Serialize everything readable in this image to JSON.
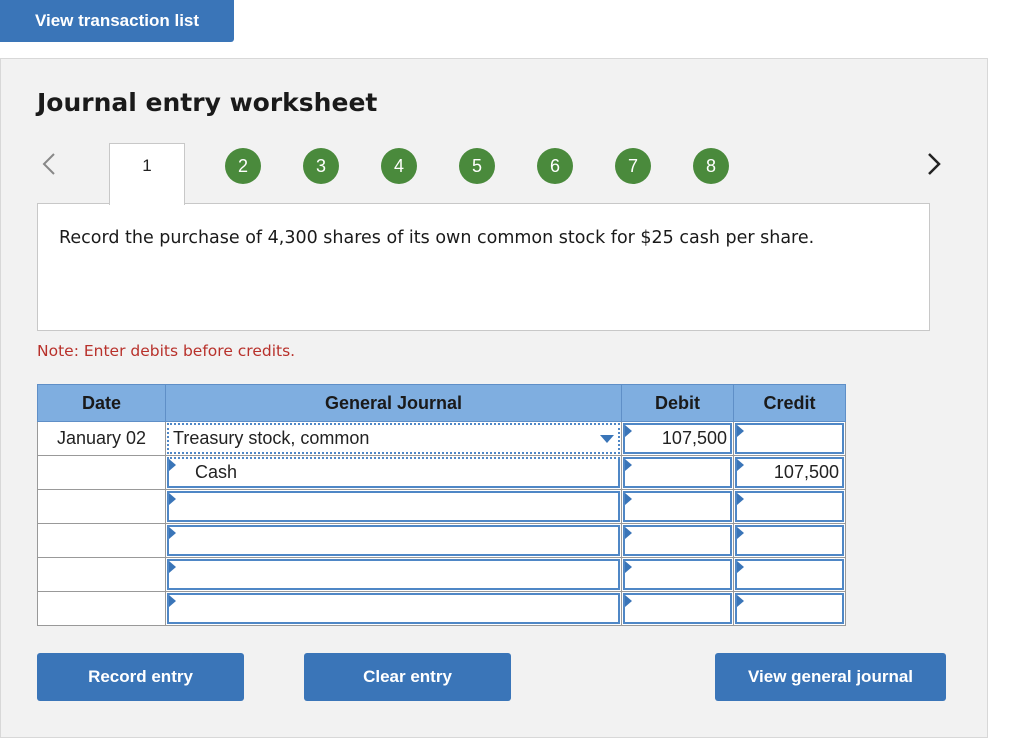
{
  "header": {
    "view_transactions_label": "View transaction list"
  },
  "worksheet": {
    "title": "Journal entry worksheet",
    "steps": [
      "1",
      "2",
      "3",
      "4",
      "5",
      "6",
      "7",
      "8"
    ],
    "active_step": "1",
    "prompt": "Record the purchase of 4,300 shares of its own common stock for $25 cash per share.",
    "note": "Note: Enter debits before credits."
  },
  "journal": {
    "headers": {
      "date": "Date",
      "account": "General Journal",
      "debit": "Debit",
      "credit": "Credit"
    },
    "rows": [
      {
        "date": "January 02",
        "account": "Treasury stock, common",
        "debit": "107,500",
        "credit": ""
      },
      {
        "date": "",
        "account": "Cash",
        "debit": "",
        "credit": "107,500"
      },
      {
        "date": "",
        "account": "",
        "debit": "",
        "credit": ""
      },
      {
        "date": "",
        "account": "",
        "debit": "",
        "credit": ""
      },
      {
        "date": "",
        "account": "",
        "debit": "",
        "credit": ""
      },
      {
        "date": "",
        "account": "",
        "debit": "",
        "credit": ""
      }
    ]
  },
  "buttons": {
    "record": "Record entry",
    "clear": "Clear entry",
    "view_journal": "View general journal"
  },
  "colors": {
    "accent": "#3a75b8",
    "step_green": "#4a8a3c",
    "header_blue": "#7faee0",
    "note_red": "#b8312b"
  },
  "icons": {
    "prev": "chevron-left-icon",
    "next": "chevron-right-icon",
    "dropdown": "caret-down-icon"
  }
}
